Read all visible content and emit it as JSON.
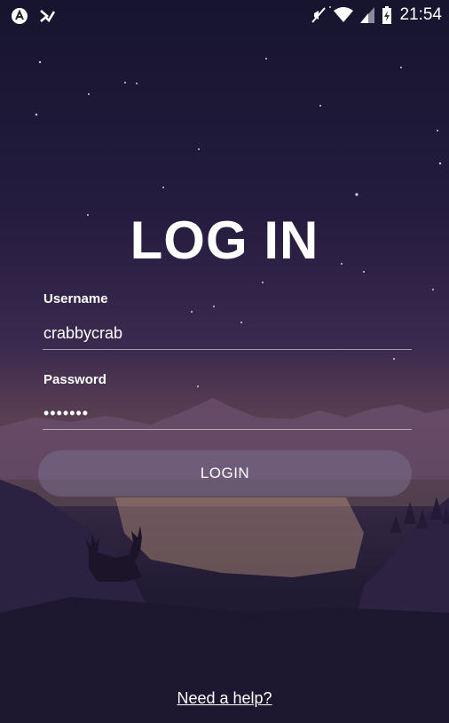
{
  "status_bar": {
    "time": "21:54",
    "left_icons": [
      "app-a-icon",
      "app-check-icon"
    ],
    "right_icons": [
      "mute-icon",
      "wifi-icon",
      "signal-icon",
      "battery-charging-icon"
    ]
  },
  "login": {
    "title": "LOG IN",
    "username_label": "Username",
    "username_value": "crabbycrab",
    "password_label": "Password",
    "password_value": "•••••••",
    "button_label": "LOGIN",
    "help_link": "Need a help?"
  },
  "colors": {
    "background_top": "#16142e",
    "background_mid": "#5a3f52",
    "button_fill": "#786e8c",
    "text": "#ffffff"
  }
}
